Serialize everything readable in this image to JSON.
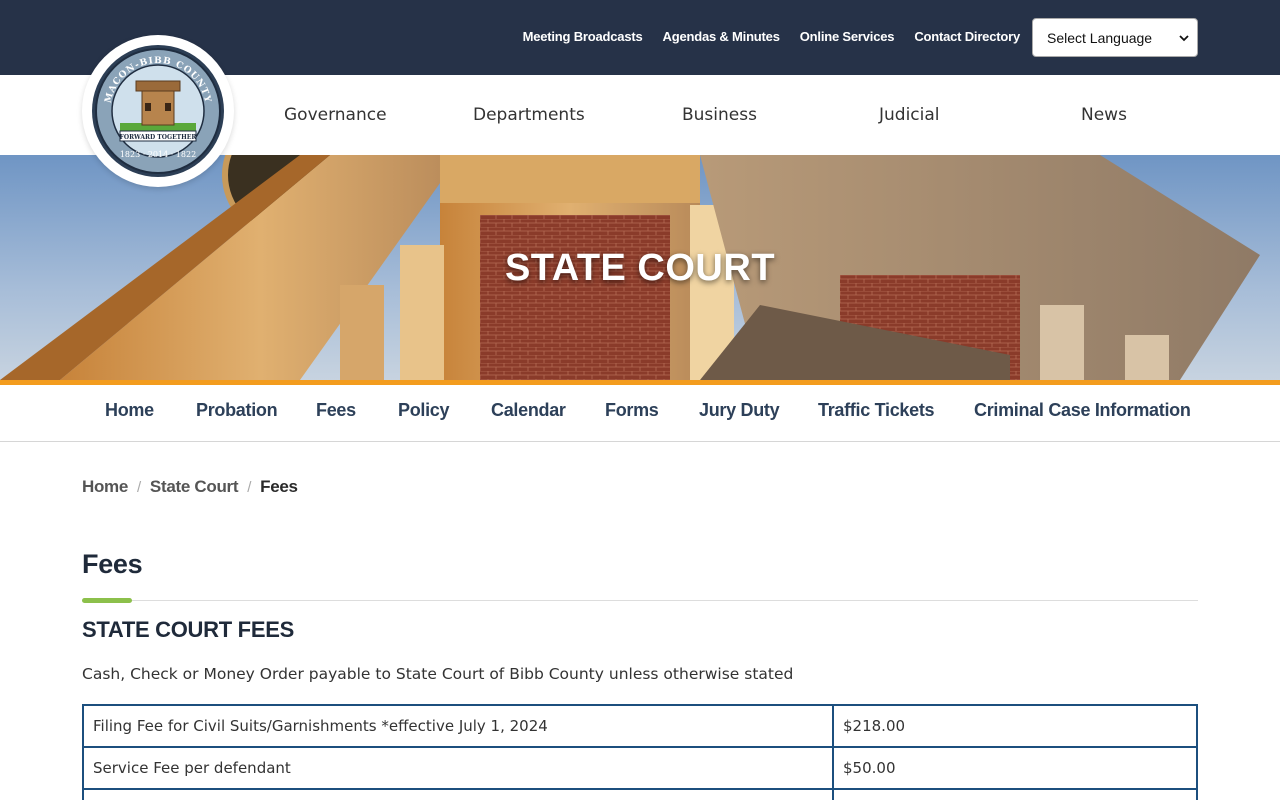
{
  "utility_nav": {
    "links": [
      "Meeting Broadcasts",
      "Agendas & Minutes",
      "Online Services",
      "Contact Directory"
    ],
    "language_select": "Select Language"
  },
  "logo": {
    "text_top": "MACON-BIBB COUNTY",
    "motto": "FORWARD TOGETHER",
    "years": "1823 · 2014 · 1822"
  },
  "main_nav": {
    "items": [
      "Governance",
      "Departments",
      "Business",
      "Judicial",
      "News"
    ]
  },
  "hero": {
    "title": "STATE COURT"
  },
  "sub_nav": {
    "items": [
      "Home",
      "Probation",
      "Fees",
      "Policy",
      "Calendar",
      "Forms",
      "Jury Duty",
      "Traffic Tickets",
      "Criminal Case Information"
    ]
  },
  "breadcrumb": [
    "Home",
    "State Court",
    "Fees"
  ],
  "page": {
    "title": "Fees",
    "section_title": "STATE COURT FEES",
    "intro": "Cash, Check or Money Order payable to State Court of Bibb County unless otherwise stated"
  },
  "fees": [
    {
      "description": "Filing Fee for Civil Suits/Garnishments *effective July 1, 2024",
      "amount": "$218.00"
    },
    {
      "description": "Service Fee per defendant",
      "amount": "$50.00"
    },
    {
      "description": "",
      "amount": ""
    }
  ],
  "colors": {
    "topbar": "#263248",
    "accent_orange": "#f39c1e",
    "accent_green": "#8cc04b",
    "subnav_text": "#2d4059",
    "table_border": "#1c4f7e"
  }
}
